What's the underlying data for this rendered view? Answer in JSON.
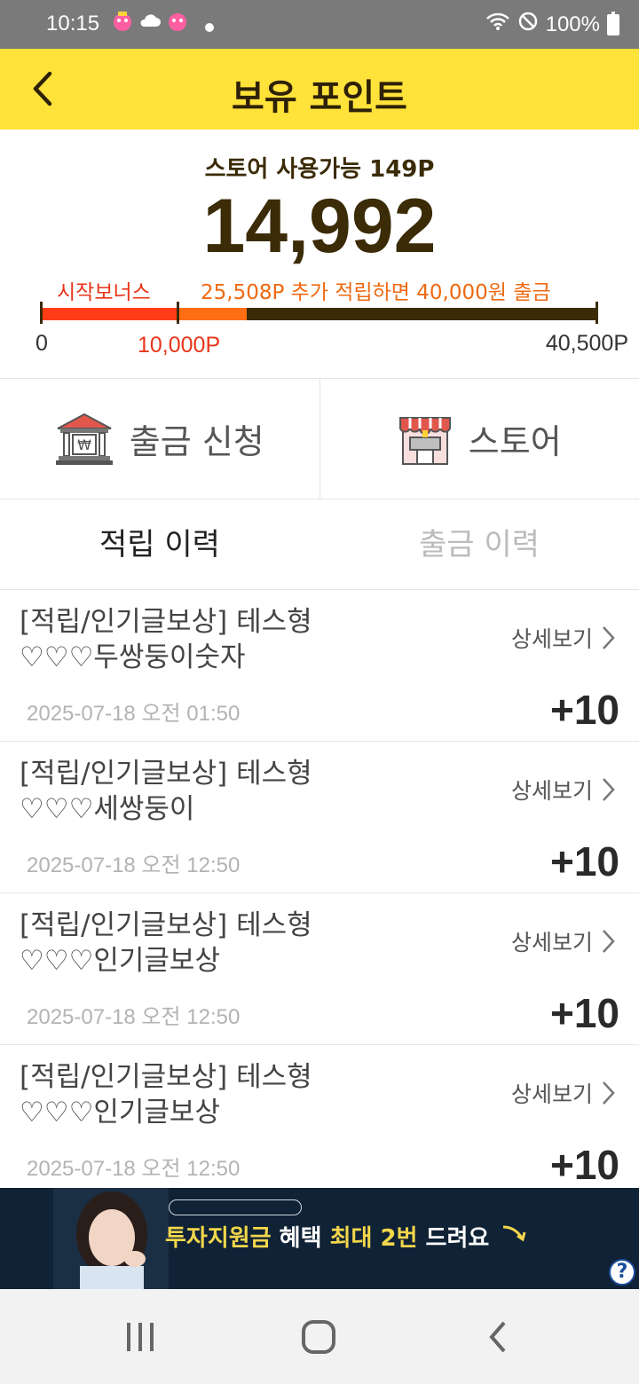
{
  "status_bar": {
    "time": "10:15",
    "battery": "100%"
  },
  "header": {
    "title": "보유 포인트"
  },
  "summary": {
    "store_available": "스토어 사용가능 149P",
    "total_points": "14,992",
    "bonus_label": "시작보너스",
    "goal_message": "25,508P 추가 적립하면 40,000원 출금",
    "progress": {
      "bonus_end": 10000,
      "current": 14992,
      "max": 40500
    },
    "scale_start": "0",
    "scale_bonus": "10,000P",
    "scale_max": "40,500P",
    "colors": {
      "bonus": "#ff3c16",
      "earned": "#ff6e12",
      "remaining": "#3b2b06"
    }
  },
  "actions": {
    "withdraw": {
      "label": "출금 신청",
      "icon": "bank-icon"
    },
    "store": {
      "label": "스토어",
      "icon": "store-icon"
    }
  },
  "tabs": {
    "earn_history": "적립 이력",
    "withdraw_history": "출금 이력"
  },
  "history": [
    {
      "title": "[적립/인기글보상] 테스형 ♡♡♡두쌍둥이숫자",
      "detail": "상세보기",
      "date": "2025-07-18 오전 01:50",
      "amount": "+10"
    },
    {
      "title": "[적립/인기글보상] 테스형 ♡♡♡세쌍둥이",
      "detail": "상세보기",
      "date": "2025-07-18 오전 12:50",
      "amount": "+10"
    },
    {
      "title": "[적립/인기글보상] 테스형 ♡♡♡인기글보상",
      "detail": "상세보기",
      "date": "2025-07-18 오전 12:50",
      "amount": "+10"
    },
    {
      "title": "[적립/인기글보상] 테스형 ♡♡♡인기글보상",
      "detail": "상세보기",
      "date": "2025-07-18 오전 12:50",
      "amount": "+10"
    }
  ],
  "ad": {
    "headline_prefix": "투자지원금",
    "headline_mid": " 혜택 ",
    "headline_highlight": "최대 2번",
    "headline_suffix": " 드려요",
    "help": "?"
  }
}
